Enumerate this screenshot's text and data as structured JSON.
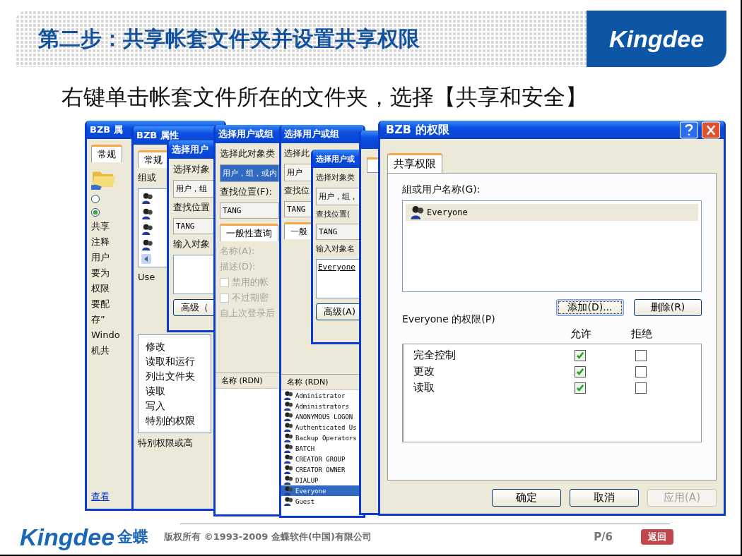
{
  "slide": {
    "title": "第二步：共享帐套文件夹并设置共享权限",
    "logo": "Kingdee",
    "subtitle": "右键单击帐套文件所在的文件夹，选择【共享和安全】"
  },
  "windows": [
    {
      "title": "BZB 属",
      "items": [
        {
          "kind": "tab",
          "label": "常规",
          "selected": true
        },
        {
          "kind": "folder"
        },
        {
          "kind": "radio",
          "selected": false
        },
        {
          "kind": "radio",
          "selected": true
        },
        {
          "kind": "label",
          "text": "共享"
        },
        {
          "kind": "label",
          "text": "注释"
        },
        {
          "kind": "label",
          "text": "用户"
        },
        {
          "kind": "label",
          "text": "要为"
        },
        {
          "kind": "label",
          "text": "权限"
        },
        {
          "kind": "label",
          "text": "要配"
        },
        {
          "kind": "label",
          "text": "存”"
        },
        {
          "kind": "label",
          "text": "Windo"
        },
        {
          "kind": "label",
          "text": "机共"
        },
        {
          "kind": "link",
          "text": "查看"
        }
      ]
    },
    {
      "title": "BZB 属性",
      "items": [
        {
          "kind": "tab",
          "label": "常规",
          "selected": true
        },
        {
          "kind": "label",
          "text": "组或"
        },
        {
          "kind": "users",
          "entries": [
            {
              "selected": false
            },
            {
              "selected": false
            },
            {
              "selected": false
            },
            {
              "selected": false
            }
          ]
        },
        {
          "kind": "label",
          "text": "Use"
        },
        {
          "kind": "list",
          "entries": [
            {
              "text": "修改"
            },
            {
              "text": "读取和运行"
            },
            {
              "text": "列出文件夹"
            },
            {
              "text": "读取"
            },
            {
              "text": "写入"
            },
            {
              "text": "特别的权限"
            }
          ]
        },
        {
          "kind": "label",
          "text": "特别权限或高"
        }
      ]
    },
    {
      "title": "选择用户",
      "items": [
        {
          "kind": "label",
          "text": "选择对象"
        },
        {
          "kind": "field",
          "value": "用户，组",
          "selected": false
        },
        {
          "kind": "label",
          "text": "查找位置"
        },
        {
          "kind": "field",
          "value": "TANG",
          "selected": false
        },
        {
          "kind": "label",
          "text": "输入对象"
        },
        {
          "kind": "textarea",
          "value": ""
        },
        {
          "kind": "button",
          "label": "高级（"
        }
      ]
    },
    {
      "title": "选择用户或组",
      "items": [
        {
          "kind": "label",
          "text": "选择此对象类"
        },
        {
          "kind": "field",
          "value": "用户，组，或内",
          "selected": true
        },
        {
          "kind": "label",
          "text": "查找位置(F):"
        },
        {
          "kind": "field",
          "value": "TANG",
          "selected": false
        },
        {
          "kind": "tab",
          "label": "一般性查询",
          "selected": true
        },
        {
          "kind": "label",
          "text": "名称(A):",
          "disabled": true
        },
        {
          "kind": "label",
          "text": "描述(D):",
          "disabled": true
        },
        {
          "kind": "checkbox",
          "label": "禁用的帐",
          "checked": false,
          "disabled": true
        },
        {
          "kind": "checkbox",
          "label": "不过期密",
          "checked": false,
          "disabled": true
        },
        {
          "kind": "label",
          "text": "自上次登录后",
          "disabled": true
        },
        {
          "kind": "results",
          "header": "名称 (RDN)"
        }
      ]
    },
    {
      "title": "选择用户或组",
      "items": [
        {
          "kind": "label",
          "text": "选择此"
        },
        {
          "kind": "field",
          "value": "用户",
          "selected": false
        },
        {
          "kind": "label",
          "text": "查找位"
        },
        {
          "kind": "field",
          "value": "TANG",
          "selected": false
        },
        {
          "kind": "tab",
          "label": "一般",
          "selected": true
        },
        {
          "kind": "results",
          "header": "名称 (RDN)",
          "entries": [
            {
              "text": "Administrator",
              "selected": false
            },
            {
              "text": "Administrators",
              "selected": false
            },
            {
              "text": "ANONYMOUS LOGON",
              "selected": false
            },
            {
              "text": "Authenticated Us",
              "selected": false
            },
            {
              "text": "Backup Operators",
              "selected": false
            },
            {
              "text": "BATCH",
              "selected": false
            },
            {
              "text": "CREATOR GROUP",
              "selected": false
            },
            {
              "text": "CREATOR OWNER",
              "selected": false
            },
            {
              "text": "DIALUP",
              "selected": false
            },
            {
              "text": "Everyone",
              "selected": true
            },
            {
              "text": "Guest",
              "selected": false
            }
          ]
        }
      ]
    },
    {
      "title": "选择用户或",
      "items": [
        {
          "kind": "label",
          "text": "选择对象类"
        },
        {
          "kind": "field",
          "value": "用户，组，",
          "selected": false
        },
        {
          "kind": "label",
          "text": "查找位置("
        },
        {
          "kind": "field",
          "value": "TANG",
          "selected": false
        },
        {
          "kind": "label",
          "text": "输入对象名"
        },
        {
          "kind": "textarea",
          "value": "Everyone"
        },
        {
          "kind": "button",
          "label": "高级(A)"
        }
      ]
    }
  ],
  "dialog": {
    "title": "BZB 的权限",
    "tab": "共享权限",
    "group_label": "組或用户名称(G):",
    "users": [
      {
        "text": "Everyone",
        "selected": true
      }
    ],
    "add": "添加(D)...",
    "remove": "删除(R)",
    "perm_label": "Everyone 的权限(P)",
    "allow": "允许",
    "deny": "拒绝",
    "perms": [
      {
        "name": "完全控制",
        "allow": true,
        "deny": false
      },
      {
        "name": "更改",
        "allow": true,
        "deny": false
      },
      {
        "name": "读取",
        "allow": true,
        "deny": false
      }
    ],
    "buttons": [
      {
        "label": "确定",
        "disabled": false
      },
      {
        "label": "取消",
        "disabled": false
      },
      {
        "label": "应用(A)",
        "disabled": true
      }
    ]
  },
  "footer": {
    "logo": "Kingdee",
    "logo_cn": "金蝶",
    "copyright": "版权所有 ©1993-2009 金蝶软件(中国)有限公司",
    "page": "P/6",
    "back": "返回"
  }
}
